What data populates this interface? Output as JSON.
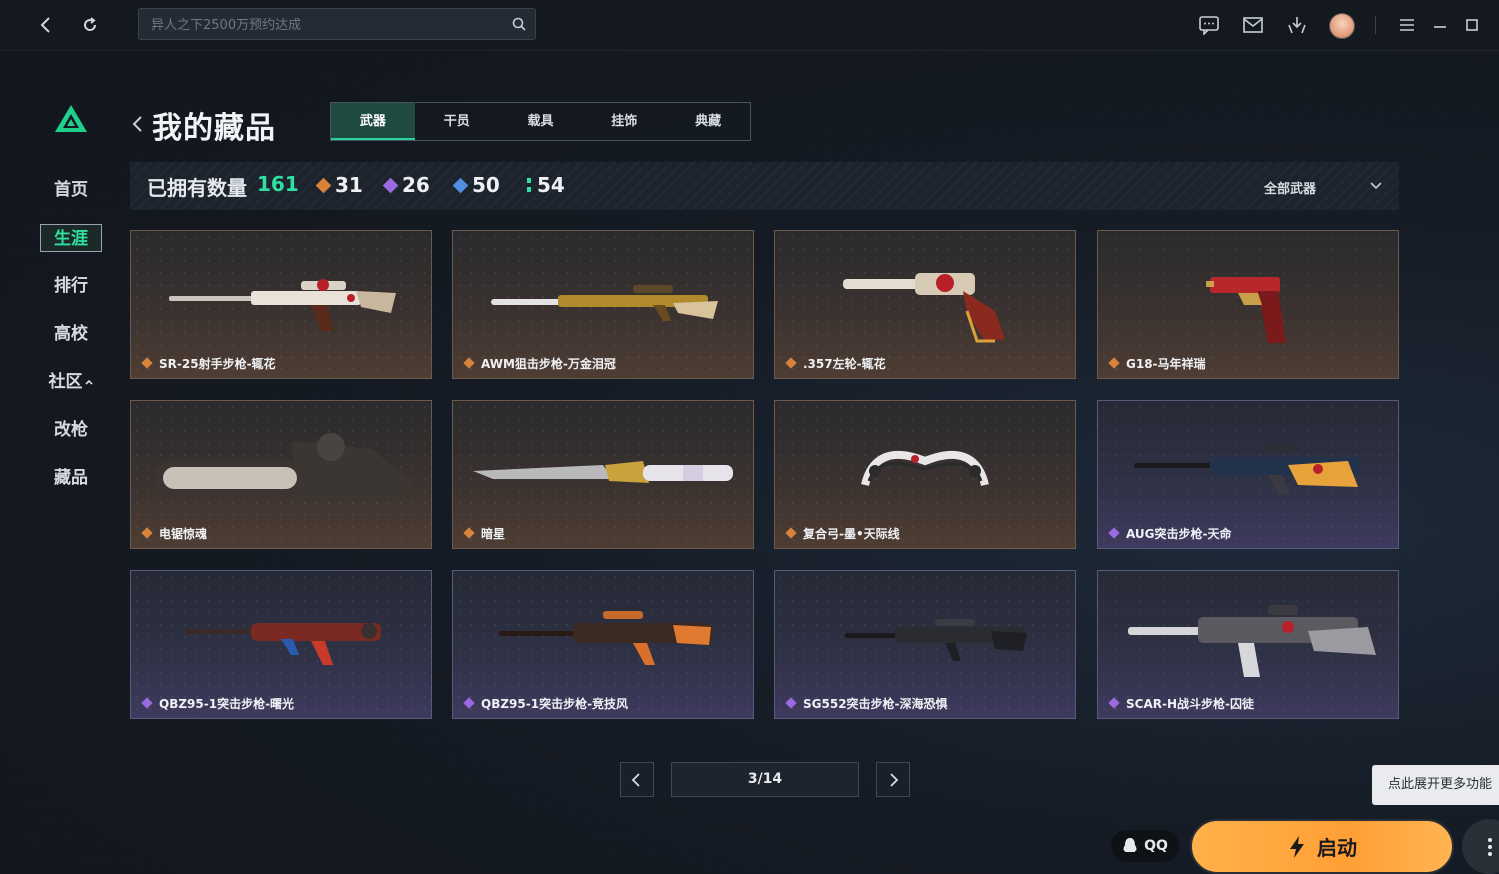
{
  "search": {
    "placeholder": "异人之下2500万预约达成"
  },
  "sidebar": {
    "items": [
      {
        "label": "首页",
        "active": false
      },
      {
        "label": "生涯",
        "active": true
      },
      {
        "label": "排行",
        "active": false
      },
      {
        "label": "高校",
        "active": false
      },
      {
        "label": "社区",
        "active": false
      },
      {
        "label": "改枪",
        "active": false
      },
      {
        "label": "藏品",
        "active": false
      }
    ]
  },
  "page": {
    "title": "我的藏品"
  },
  "tabs": [
    {
      "label": "武器",
      "active": true
    },
    {
      "label": "干员",
      "active": false
    },
    {
      "label": "载具",
      "active": false
    },
    {
      "label": "挂饰",
      "active": false
    },
    {
      "label": "典藏",
      "active": false
    }
  ],
  "stats": {
    "owned_label": "已拥有数量",
    "owned_count": "161",
    "tiers": [
      {
        "value": "31",
        "color": "#d8823a"
      },
      {
        "value": "26",
        "color": "#9a6be0"
      },
      {
        "value": "50",
        "color": "#4f8fe0"
      },
      {
        "value": "54",
        "color": "#2fe0a0"
      }
    ],
    "filter": "全部武器"
  },
  "items": [
    {
      "name": "SR-25射手步枪-辄花",
      "rarity": "orange"
    },
    {
      "name": "AWM狙击步枪-万金泪冠",
      "rarity": "orange"
    },
    {
      "name": ".357左轮-辄花",
      "rarity": "orange"
    },
    {
      "name": "G18-马年祥瑞",
      "rarity": "orange"
    },
    {
      "name": "电锯惊魂",
      "rarity": "orange"
    },
    {
      "name": "暗星",
      "rarity": "orange"
    },
    {
      "name": "复合弓-墨•天际线",
      "rarity": "orange"
    },
    {
      "name": "AUG突击步枪-天命",
      "rarity": "purple"
    },
    {
      "name": "QBZ95-1突击步枪-曙光",
      "rarity": "purple"
    },
    {
      "name": "QBZ95-1突击步枪-竞技风",
      "rarity": "purple"
    },
    {
      "name": "SG552突击步枪-深海恐惧",
      "rarity": "purple"
    },
    {
      "name": "SCAR-H战斗步枪-囚徒",
      "rarity": "purple"
    }
  ],
  "pagination": {
    "current": "3/14"
  },
  "footer": {
    "tooltip": "点此展开更多功能",
    "qq_label": "QQ",
    "launch_label": "启动"
  },
  "colors": {
    "accent": "#2fe0a0",
    "orange_rarity": "#d8823a",
    "purple_rarity": "#9a6be0",
    "launch": "#ffa53c"
  }
}
